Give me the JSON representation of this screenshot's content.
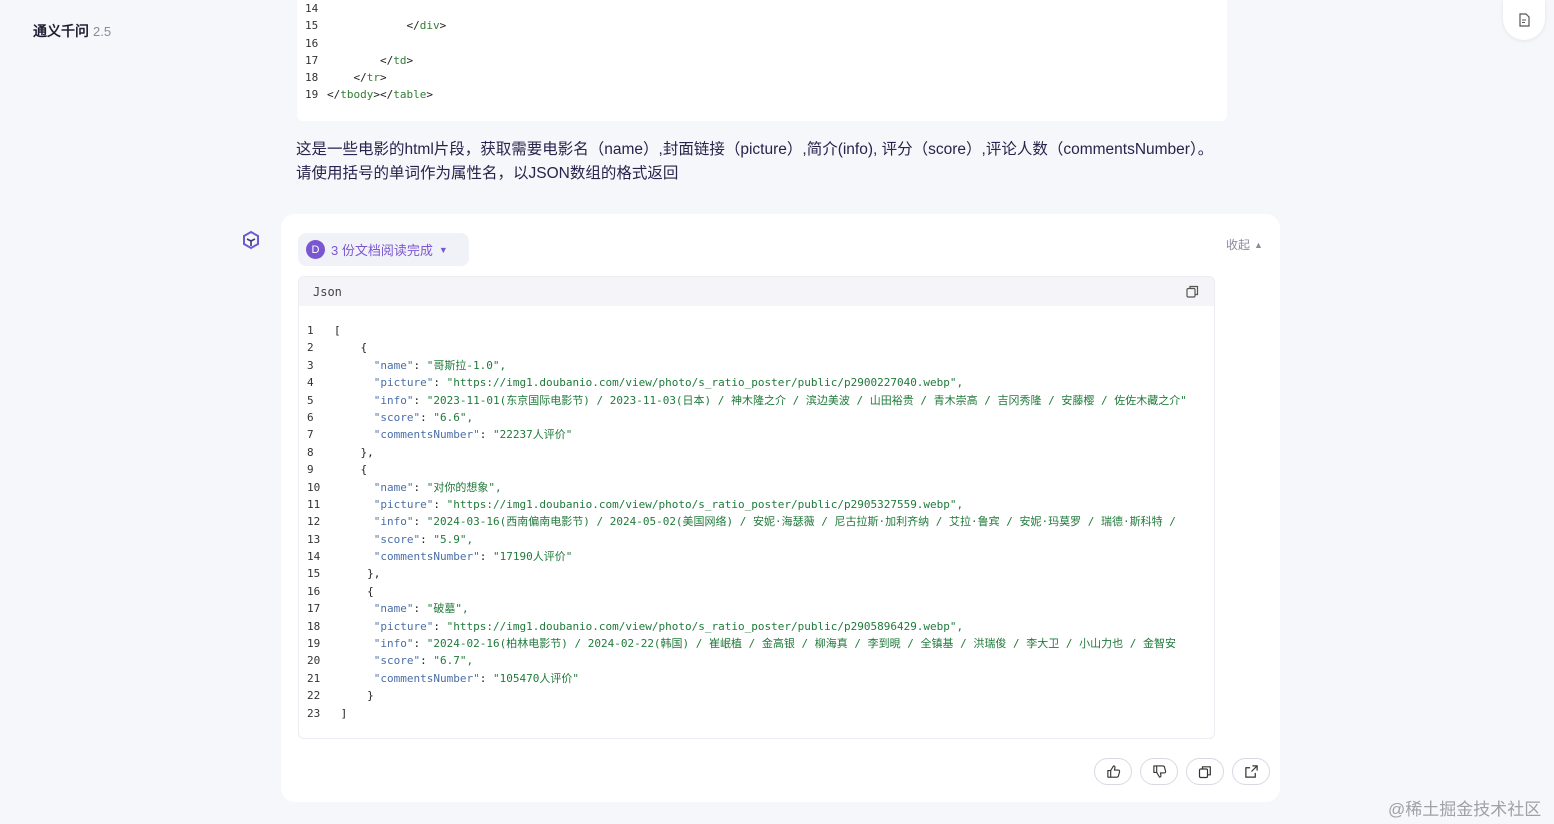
{
  "header": {
    "brand": "通义千问",
    "version": "2.5"
  },
  "user_code": {
    "lines": [
      {
        "n": "14",
        "text": ""
      },
      {
        "n": "15",
        "text": "            </div>"
      },
      {
        "n": "16",
        "text": ""
      },
      {
        "n": "17",
        "text": "        </td>"
      },
      {
        "n": "18",
        "text": "    </tr>"
      },
      {
        "n": "19",
        "text": "</tbody></table>"
      }
    ]
  },
  "question": {
    "text": "这是一些电影的html片段，获取需要电影名（name）,封面链接（picture）,简介(info), 评分（score）,评论人数（commentsNumber）。 请使用括号的单词作为属性名，以JSON数组的格式返回"
  },
  "answer": {
    "doc_chip": {
      "badge": "D",
      "label": "3 份文档阅读完成"
    },
    "collapse_label": "收起",
    "code_lang": "Json",
    "json_lines": [
      {
        "n": "1",
        "text": "["
      },
      {
        "n": "2",
        "text": "    {"
      },
      {
        "n": "3",
        "text": "      \"name\": \"哥斯拉-1.0\","
      },
      {
        "n": "4",
        "text": "      \"picture\": \"https://img1.doubanio.com/view/photo/s_ratio_poster/public/p2900227040.webp\","
      },
      {
        "n": "5",
        "text": "      \"info\": \"2023-11-01(东京国际电影节) / 2023-11-03(日本) / 神木隆之介 / 滨边美波 / 山田裕贵 / 青木崇高 / 吉冈秀隆 / 安藤樱 / 佐佐木藏之介\""
      },
      {
        "n": "6",
        "text": "      \"score\": \"6.6\","
      },
      {
        "n": "7",
        "text": "      \"commentsNumber\": \"22237人评价\""
      },
      {
        "n": "8",
        "text": "    },"
      },
      {
        "n": "9",
        "text": "    {"
      },
      {
        "n": "10",
        "text": "      \"name\": \"对你的想象\","
      },
      {
        "n": "11",
        "text": "      \"picture\": \"https://img1.doubanio.com/view/photo/s_ratio_poster/public/p2905327559.webp\","
      },
      {
        "n": "12",
        "text": "      \"info\": \"2024-03-16(西南偏南电影节) / 2024-05-02(美国网络) / 安妮·海瑟薇 / 尼古拉斯·加利齐纳 / 艾拉·鲁宾 / 安妮·玛莫罗 / 瑞德·斯科特 /"
      },
      {
        "n": "13",
        "text": "      \"score\": \"5.9\","
      },
      {
        "n": "14",
        "text": "      \"commentsNumber\": \"17190人评价\""
      },
      {
        "n": "15",
        "text": "     },"
      },
      {
        "n": "16",
        "text": "     {"
      },
      {
        "n": "17",
        "text": "      \"name\": \"破墓\","
      },
      {
        "n": "18",
        "text": "      \"picture\": \"https://img1.doubanio.com/view/photo/s_ratio_poster/public/p2905896429.webp\","
      },
      {
        "n": "19",
        "text": "      \"info\": \"2024-02-16(柏林电影节) / 2024-02-22(韩国) / 崔岷植 / 金高银 / 柳海真 / 李到晛 / 全镇基 / 洪瑞俊 / 李大卫 / 小山力也 / 金智安"
      },
      {
        "n": "20",
        "text": "      \"score\": \"6.7\","
      },
      {
        "n": "21",
        "text": "      \"commentsNumber\": \"105470人评价\""
      },
      {
        "n": "22",
        "text": "     }"
      },
      {
        "n": "23",
        "text": " ]"
      }
    ]
  },
  "actions": [
    {
      "name": "like-button",
      "icon": "thumbs-up-icon"
    },
    {
      "name": "dislike-button",
      "icon": "thumbs-down-icon"
    },
    {
      "name": "copy-button",
      "icon": "copy-icon"
    },
    {
      "name": "share-button",
      "icon": "share-icon"
    }
  ],
  "watermark": "@稀土掘金技术社区"
}
